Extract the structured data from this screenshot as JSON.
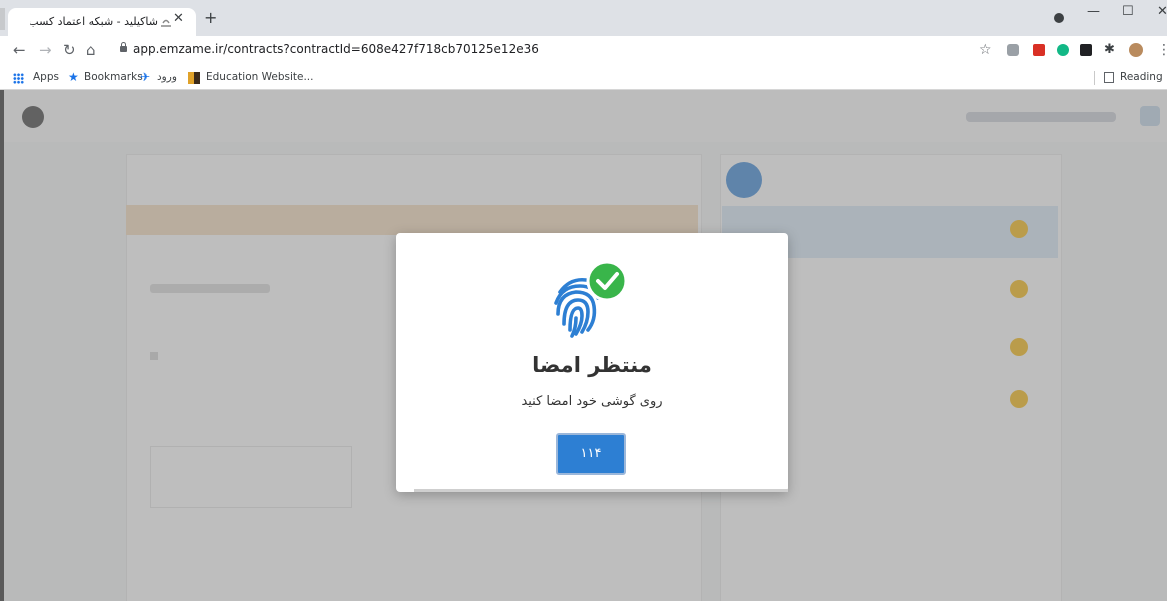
{
  "browser": {
    "tab_title": "شاکیلید - شبکه اعتماد کسب و کار",
    "url": "app.emzame.ir/contracts?contractId=608e427f718cb70125e12e36",
    "bookmarks": {
      "apps": "Apps",
      "bookmarks": "Bookmarks",
      "login": "ورود",
      "education": "Education Website...",
      "reading_list": "Reading list"
    }
  },
  "modal": {
    "title": "منتظر امضا",
    "subtitle": "روی گوشی خود امضا کنید",
    "code": "۱۱۴"
  },
  "colors": {
    "primary": "#2d7fd3",
    "success": "#39b54a"
  }
}
